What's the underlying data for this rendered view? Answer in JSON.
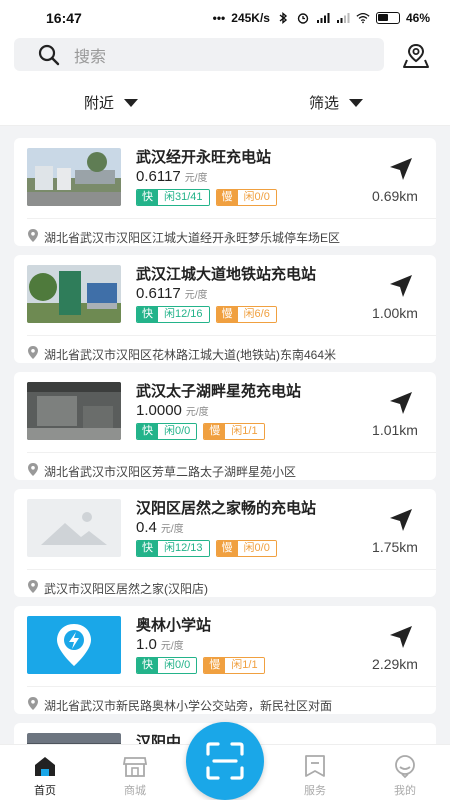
{
  "status": {
    "time": "16:47",
    "speed": "245K/s",
    "battery": "46%"
  },
  "search": {
    "placeholder": "搜索"
  },
  "filters": {
    "nearby": "附近",
    "filter": "筛选"
  },
  "labels": {
    "fast": "快",
    "slow": "慢",
    "unit": "元/度"
  },
  "stations": [
    {
      "name": "武汉经开永旺充电站",
      "price": "0.6117",
      "fast": "闲31/41",
      "slow": "闲0/0",
      "distance": "0.69km",
      "address": "湖北省武汉市汉阳区江城大道经开永旺梦乐城停车场E区",
      "thumb": "photo-station"
    },
    {
      "name": "武汉江城大道地铁站充电站",
      "price": "0.6117",
      "fast": "闲12/16",
      "slow": "闲6/6",
      "distance": "1.00km",
      "address": "湖北省武汉市汉阳区花林路江城大道(地铁站)东南464米",
      "thumb": "photo-sign"
    },
    {
      "name": "武汉太子湖畔星苑充电站",
      "price": "1.0000",
      "fast": "闲0/0",
      "slow": "闲1/1",
      "distance": "1.01km",
      "address": "湖北省武汉市汉阳区芳草二路太子湖畔星苑小区",
      "thumb": "photo-garage"
    },
    {
      "name": "汉阳区居然之家畅的充电站",
      "price": "0.4",
      "fast": "闲12/13",
      "slow": "闲0/0",
      "distance": "1.75km",
      "address": "武汉市汉阳区居然之家(汉阳店)",
      "thumb": "placeholder"
    },
    {
      "name": "奥林小学站",
      "price": "1.0",
      "fast": "闲0/0",
      "slow": "闲1/1",
      "distance": "2.29km",
      "address": "湖北省武汉市新民路奥林小学公交站旁，新民社区对面",
      "thumb": "logo"
    },
    {
      "name": "汉阳中",
      "thumb": "photo-partial"
    }
  ],
  "tabs": [
    {
      "label": "首页",
      "icon": "home-icon"
    },
    {
      "label": "商城",
      "icon": "shop-icon"
    },
    {
      "label": "服务",
      "icon": "service-icon"
    },
    {
      "label": "我的",
      "icon": "profile-icon"
    }
  ],
  "colors": {
    "fast": "#23b38a",
    "slow": "#f0a040",
    "accent": "#1aa7e8"
  }
}
